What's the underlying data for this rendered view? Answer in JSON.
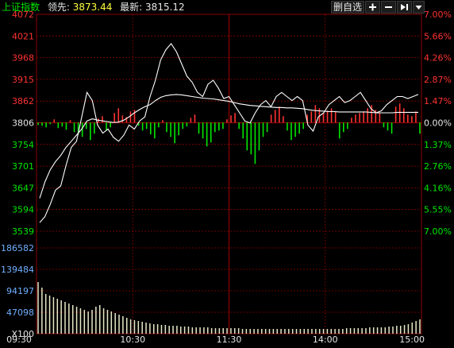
{
  "header": {
    "title": "上证指数",
    "lead_label": "领先:",
    "lead_value": "3873.44",
    "latest_label": "最新:",
    "latest_value": "3815.12"
  },
  "toolbar": {
    "remove_watchlist_label": "删自选",
    "zoom_in_icon": "plus-icon",
    "zoom_out_icon": "minus-icon",
    "jump_end_icon": "skip-end-icon",
    "menu_icon": "dropdown-arrow-icon"
  },
  "colors": {
    "up": "#ff3232",
    "down": "#00e600",
    "price_line": "#ffffff",
    "avg_line": "#ffffff",
    "grid": "#8b0000",
    "axis_text_price": "#ff3232",
    "axis_text_volume": "#70b0ff",
    "volume_bars": "#e8e8c8"
  },
  "chart_data": {
    "type": "line",
    "title": "上证指数",
    "price_axis": [
      "4072",
      "4021",
      "3968",
      "3915",
      "3862",
      "3806",
      "3754",
      "3701",
      "3647",
      "3594",
      "3539"
    ],
    "percent_axis": [
      "7.00%",
      "5.66%",
      "4.26%",
      "2.87%",
      "1.47%",
      "0.00%",
      "1.37%",
      "2.76%",
      "4.16%",
      "5.55%",
      "7.00%"
    ],
    "volume_axis": [
      "186582",
      "139484",
      "94197",
      "47098",
      "X100"
    ],
    "time_axis": [
      "09:30",
      "10:30",
      "11:30",
      "14:00",
      "15:00"
    ],
    "ylim": [
      3539,
      4072
    ],
    "prev_close": 3806,
    "series": [
      {
        "name": "最新",
        "values": [
          3560,
          3575,
          3605,
          3640,
          3650,
          3700,
          3745,
          3760,
          3820,
          3880,
          3860,
          3800,
          3780,
          3790,
          3770,
          3760,
          3775,
          3800,
          3790,
          3810,
          3820,
          3870,
          3910,
          3960,
          3985,
          4000,
          3980,
          3950,
          3920,
          3905,
          3880,
          3870,
          3900,
          3910,
          3890,
          3865,
          3870,
          3850,
          3830,
          3810,
          3805,
          3830,
          3850,
          3860,
          3845,
          3870,
          3880,
          3870,
          3860,
          3870,
          3860,
          3800,
          3785,
          3820,
          3830,
          3850,
          3860,
          3870,
          3855,
          3860,
          3870,
          3880,
          3860,
          3840,
          3830,
          3835,
          3850,
          3860,
          3870,
          3870,
          3865,
          3870,
          3875
        ]
      },
      {
        "name": "均价",
        "values": [
          3620,
          3660,
          3690,
          3710,
          3725,
          3745,
          3760,
          3775,
          3790,
          3810,
          3815,
          3812,
          3810,
          3808,
          3806,
          3807,
          3812,
          3820,
          3830,
          3838,
          3845,
          3850,
          3860,
          3868,
          3872,
          3874,
          3875,
          3874,
          3872,
          3870,
          3868,
          3866,
          3865,
          3864,
          3862,
          3860,
          3858,
          3855,
          3852,
          3850,
          3848,
          3847,
          3846,
          3845,
          3844,
          3843,
          3843,
          3842,
          3842,
          3841,
          3840,
          3838,
          3836,
          3835,
          3834,
          3833,
          3833,
          3832,
          3832,
          3832,
          3832,
          3832,
          3832,
          3831,
          3830,
          3830,
          3830,
          3830,
          3831,
          3831,
          3831,
          3831,
          3831
        ]
      }
    ],
    "breadth": [
      -3,
      -4,
      -6,
      -2,
      4,
      -7,
      -5,
      -9,
      3,
      -12,
      -15,
      -18,
      -8,
      -22,
      -14,
      5,
      8,
      -10,
      -6,
      12,
      18,
      9,
      7,
      14,
      16,
      -4,
      -10,
      -8,
      -15,
      -20,
      -6,
      3,
      -12,
      -18,
      -26,
      -16,
      -8,
      -5,
      6,
      10,
      -14,
      -20,
      -30,
      -25,
      -12,
      -10,
      -8,
      4,
      9,
      12,
      -8,
      -20,
      -35,
      -40,
      -52,
      -35,
      -18,
      -12,
      10,
      16,
      20,
      8,
      -10,
      -22,
      -18,
      -14,
      -8,
      10,
      14,
      22,
      18,
      12,
      15,
      18,
      14,
      -20,
      -12,
      -8,
      6,
      10,
      12,
      14,
      18,
      22,
      16,
      12,
      -6,
      -10,
      -14,
      20,
      24,
      18,
      10,
      8,
      14,
      -14
    ],
    "volume": [
      65,
      58,
      50,
      48,
      46,
      44,
      42,
      40,
      38,
      36,
      34,
      32,
      30,
      28,
      30,
      34,
      36,
      32,
      30,
      28,
      26,
      24,
      22,
      20,
      18,
      17,
      16,
      15,
      14,
      13,
      12,
      12,
      11,
      11,
      10,
      10,
      10,
      9,
      9,
      9,
      8,
      8,
      8,
      8,
      8,
      7,
      7,
      7,
      7,
      7,
      7,
      7,
      7,
      6,
      6,
      6,
      6,
      6,
      6,
      6,
      6,
      6,
      6,
      6,
      6,
      6,
      6,
      6,
      6,
      6,
      6,
      6,
      6,
      6,
      6,
      6,
      6,
      6,
      6,
      6,
      7,
      7,
      7,
      7,
      7,
      7,
      8,
      8,
      8,
      8,
      8,
      9,
      9,
      10,
      10,
      11,
      12,
      14,
      16,
      18
    ]
  }
}
